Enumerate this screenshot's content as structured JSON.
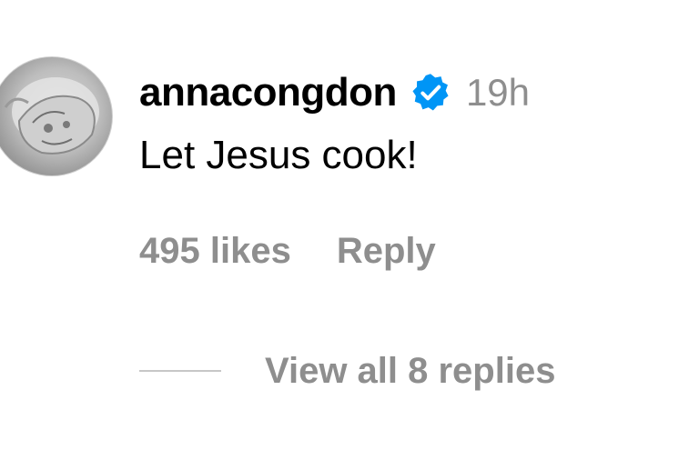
{
  "comment": {
    "username": "annacongdon",
    "verified_icon": "verified-badge-icon",
    "timestamp": "19h",
    "text": "Let Jesus cook!",
    "likes": "495 likes",
    "reply_label": "Reply",
    "view_replies_label": "View all 8 replies"
  },
  "colors": {
    "username": "#000000",
    "muted": "#8e8e8e",
    "verified_blue": "#0095f6",
    "divider": "#c7c7c7"
  }
}
